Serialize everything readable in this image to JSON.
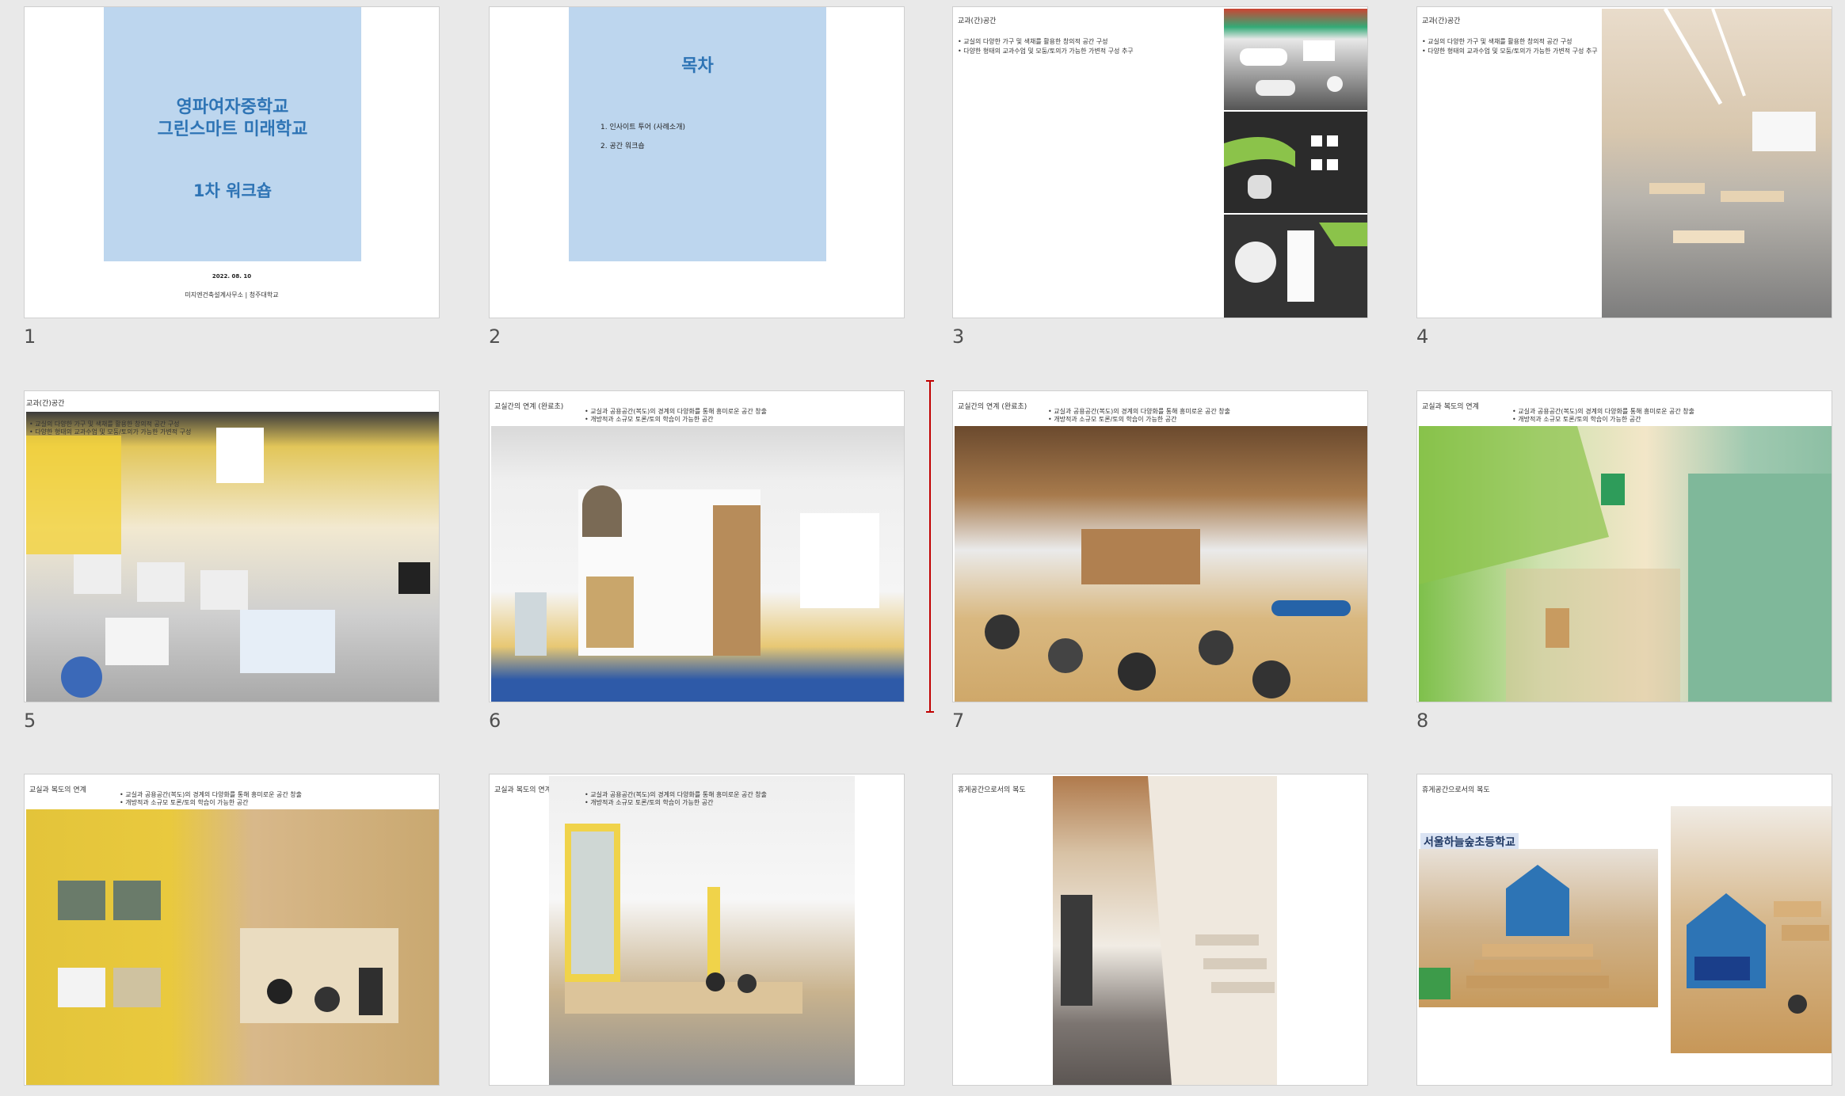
{
  "slides": [
    {
      "number": "1",
      "title_line1": "영파여자중학교",
      "title_line2": "그린스마트 미래학교",
      "subtitle": "1차 워크숍",
      "date": "2022. 08. 10",
      "org": "미지엔건축설계사무소 | 청주대학교"
    },
    {
      "number": "2",
      "title": "목차",
      "items": [
        "1.  인사이트 투어 (사례소개)",
        "2.  공간 워크숍"
      ]
    },
    {
      "number": "3",
      "heading": "교과(간)공간",
      "bullets": [
        "• 교실의 다양한 가구 및 색채를 활용한 창의적 공간 구성",
        "• 다양한 형태의 교과수업 및 모둠/토의가 가능한 가변적 구성 추구"
      ]
    },
    {
      "number": "4",
      "heading": "교과(간)공간",
      "bullets": [
        "• 교실의 다양한 가구 및 색채를 활용한 창의적 공간 구성",
        "• 다양한 형태의 교과수업 및 모둠/토의가 가능한 가변적 구성 추구"
      ]
    },
    {
      "number": "5",
      "heading": "교과(간)공간",
      "bullets": [
        "• 교실의 다양한 가구 및 색채를 활용한 창의적 공간 구성",
        "• 다양한 형태의 교과수업 및 모둠/토의가 가능한 가변적 구성"
      ]
    },
    {
      "number": "6",
      "heading": "교실간의 연계 (완료초)",
      "bullets": [
        "• 교실과 공용공간(복도)의 경계의 다양화를 통해 흥미로운 공간 창출",
        "• 개방적과 소규모 토론/토의 학습이 가능한 공간"
      ]
    },
    {
      "number": "7",
      "heading": "교실간의 연계 (완료초)",
      "bullets": [
        "• 교실과 공용공간(복도)의 경계의 다양화를 통해 흥미로운 공간 창출",
        "• 개방적과 소규모 토론/토의 학습이 가능한 공간"
      ]
    },
    {
      "number": "8",
      "heading": "교실과 복도의 연계",
      "bullets": [
        "• 교실과 공용공간(복도)의 경계의 다양화를 통해 흥미로운 공간 창출",
        "• 개방적과 소규모 토론/토의 학습이 가능한 공간"
      ]
    },
    {
      "number": "9",
      "heading": "교실과 복도의 연계",
      "bullets": [
        "• 교실과 공용공간(복도)의 경계의 다양화를 통해 흥미로운 공간 창출",
        "• 개방적과 소규모 토론/토의 학습이 가능한 공간"
      ]
    },
    {
      "number": "10",
      "heading": "교실과 복도의 연계",
      "bullets": [
        "• 교실과 공용공간(복도)의 경계의 다양화를 통해 흥미로운 공간 창출",
        "• 개방적과 소규모 토론/토의 학습이 가능한 공간"
      ]
    },
    {
      "number": "11",
      "heading": "휴게공간으로서의 복도"
    },
    {
      "number": "12",
      "heading": "휴게공간으로서의 복도",
      "school_label": "서울하늘숲초등학교"
    }
  ],
  "colors": {
    "title_box": "#bdd6ee",
    "title_text": "#2e74b5",
    "canvas": "#e9e9e9",
    "insertion_marker": "#c00000"
  }
}
